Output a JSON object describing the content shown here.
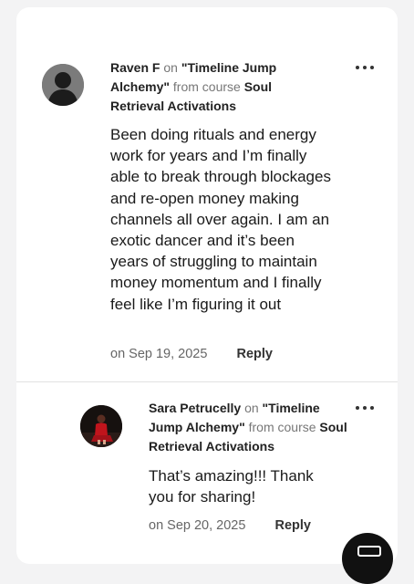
{
  "comments": [
    {
      "author": "Raven F",
      "on_word": "on",
      "lesson": "\"Timeline Jump Alchemy\"",
      "from_course": "from course",
      "course": "Soul Retrieval Activations",
      "text": "Been doing rituals and energy work for years and I’m finally able to break through blockages and re-open money making channels all over again. I am an exotic dancer and it’s been years of struggling to maintain money momentum and I finally feel like I’m figuring it out",
      "date": "on Sep 19, 2025",
      "reply_label": "Reply",
      "avatar_icon": "default-user-avatar",
      "menu_icon": "more-options-icon"
    },
    {
      "author": "Sara Petrucelly",
      "on_word": "on",
      "lesson": "\"Timeline Jump Alchemy\"",
      "from_course": "from course",
      "course": "Soul Retrieval Activations",
      "text": "That’s amazing!!! Thank you for sharing!",
      "date": "on Sep 20, 2025",
      "reply_label": "Reply",
      "avatar_icon": "user-photo-avatar",
      "menu_icon": "more-options-icon"
    }
  ],
  "floating_button_icon": "chat-icon",
  "colors": {
    "page_bg": "#f3f3f4",
    "card_bg": "#ffffff",
    "divider": "#e2e2e2",
    "fab": "#111111"
  }
}
